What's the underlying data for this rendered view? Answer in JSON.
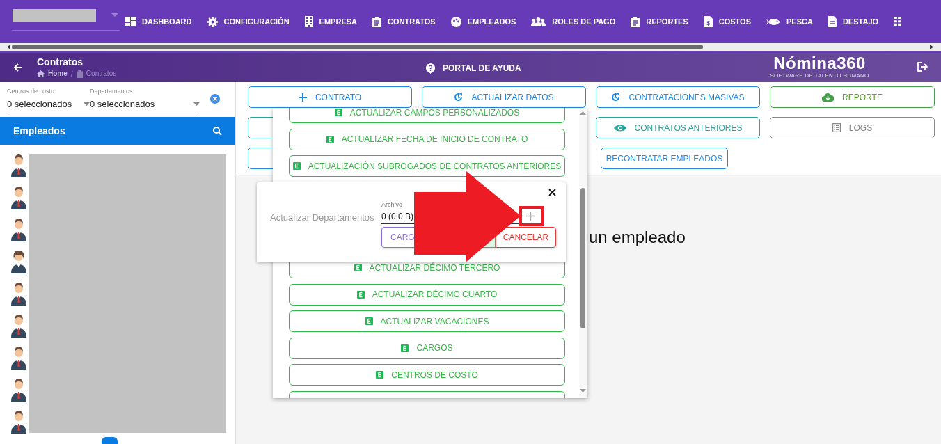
{
  "nav": [
    {
      "label": "DASHBOARD"
    },
    {
      "label": "CONFIGURACIÓN"
    },
    {
      "label": "EMPRESA"
    },
    {
      "label": "CONTRATOS"
    },
    {
      "label": "EMPLEADOS"
    },
    {
      "label": "ROLES DE PAGO"
    },
    {
      "label": "REPORTES"
    },
    {
      "label": "COSTOS"
    },
    {
      "label": "PESCA"
    },
    {
      "label": "DESTAJO"
    }
  ],
  "header": {
    "title": "Contratos",
    "breadcrumb_separator": "/",
    "breadcrumb": [
      {
        "label": "Home",
        "current": false
      },
      {
        "label": "Contratos",
        "current": true
      }
    ],
    "help": "PORTAL DE AYUDA",
    "logo": "Nómina360",
    "logo_tagline": "SOFTWARE DE TALENTO HUMANO"
  },
  "filters": [
    {
      "label": "Centros de costo",
      "value": "0 seleccionados"
    },
    {
      "label": "Departamentos",
      "value": "0 seleccionados"
    }
  ],
  "employees_panel": {
    "title": "Empleados"
  },
  "employees": [
    {
      "kind": "man"
    },
    {
      "kind": "man"
    },
    {
      "kind": "man"
    },
    {
      "kind": "woman"
    },
    {
      "kind": "man"
    },
    {
      "kind": "man"
    },
    {
      "kind": "man"
    },
    {
      "kind": "man"
    },
    {
      "kind": "man"
    }
  ],
  "actions": [
    {
      "label": "CONTRATO",
      "color": "#1e88e5"
    },
    {
      "label": "ACTUALIZAR DATOS",
      "color": "#1e88e5"
    },
    {
      "label": "CONTRATACIONES MASIVAS",
      "color": "#1e88e5"
    },
    {
      "label": "REPORTE",
      "color": "#43a047"
    },
    {
      "color": "#26a69a"
    },
    {
      "label": "CONTRATOS ANTERIORES",
      "color": "#26a69a"
    },
    {
      "label": "LOGS",
      "color": "#8a8a8a"
    },
    {
      "color": "#1e88e5"
    },
    {
      "label": "RECONTRATAR EMPLEADOS",
      "color": "#1e88e5"
    }
  ],
  "empty_message": "un empleado",
  "menu_items_top": [
    {
      "label": "ACTUALIZAR CAMPOS PERSONALIZADOS"
    },
    {
      "label": "ACTUALIZAR FECHA DE INICIO DE CONTRATO"
    },
    {
      "label": "ACTUALIZACIÓN SUBROGADOS DE CONTRATOS ANTERIORES"
    }
  ],
  "menu_items_bottom": [
    {
      "label": "ACTUALIZAR DÉCIMO TERCERO"
    },
    {
      "label": "ACTUALIZAR DÉCIMO CUARTO"
    },
    {
      "label": "ACTUALIZAR VACACIONES"
    },
    {
      "label": "CARGOS"
    },
    {
      "label": "CENTROS DE COSTO"
    }
  ],
  "dialog": {
    "title": "Actualizar Departamentos",
    "file_label": "Archivo",
    "file_value": "0 (0.0 B)",
    "buttons": [
      {
        "label": "CARG",
        "kind": "upload"
      },
      {
        "kind": "confirm"
      },
      {
        "label": "CANCELAR",
        "kind": "cancel"
      }
    ]
  }
}
